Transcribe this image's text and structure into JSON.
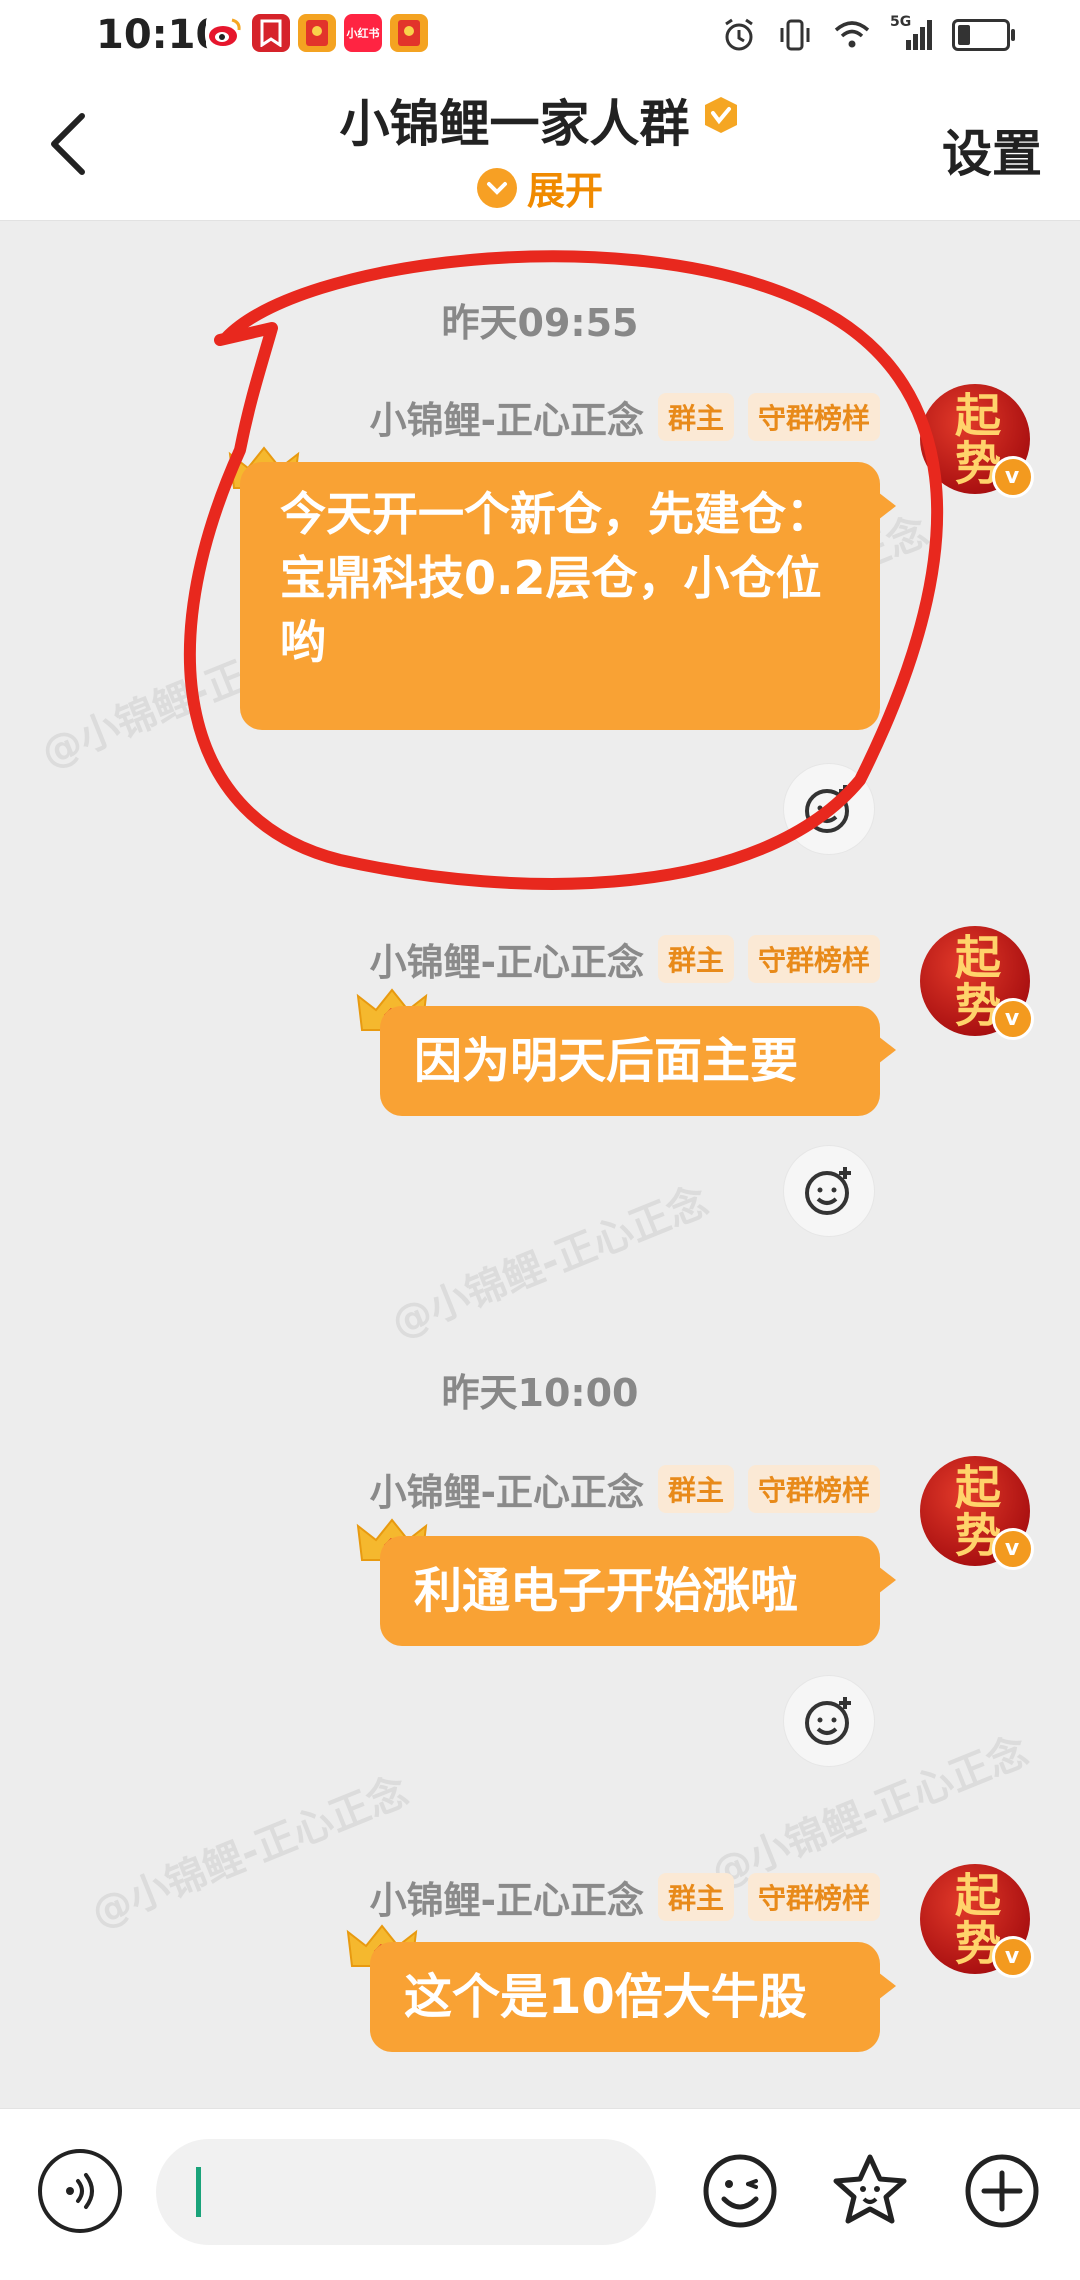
{
  "status_bar": {
    "time": "10:10",
    "app_icons": [
      "weibo-icon",
      "bookmark-icon",
      "red-envelope-icon",
      "xiaohongshu-icon",
      "red-envelope-icon"
    ],
    "xiaohongshu_label": "小红书",
    "network_label": "5G"
  },
  "header": {
    "title": "小锦鲤一家人群",
    "expand_label": "展开",
    "settings_label": "设置"
  },
  "chat": {
    "timestamps": [
      "昨天09:55",
      "昨天10:00"
    ],
    "watermark": "@小锦鲤-正心正念",
    "messages": [
      {
        "sender": "小锦鲤-正心正念",
        "tag_owner": "群主",
        "tag_role": "守群榜样",
        "avatar_text": "起势",
        "text": "今天开一个新仓，先建仓：宝鼎科技0.2层仓，小仓位哟"
      },
      {
        "sender": "小锦鲤-正心正念",
        "tag_owner": "群主",
        "tag_role": "守群榜样",
        "avatar_text": "起势",
        "text": "因为明天后面主要"
      },
      {
        "sender": "小锦鲤-正心正念",
        "tag_owner": "群主",
        "tag_role": "守群榜样",
        "avatar_text": "起势",
        "text": "利通电子开始涨啦"
      },
      {
        "sender": "小锦鲤-正心正念",
        "tag_owner": "群主",
        "tag_role": "守群榜样",
        "avatar_text": "起势",
        "text": "这个是10倍大牛股"
      }
    ]
  },
  "bottom_bar": {
    "input_value": ""
  },
  "colors": {
    "bubble": "#f9a234",
    "accent": "#f08a00",
    "annotation": "#e8281e"
  }
}
